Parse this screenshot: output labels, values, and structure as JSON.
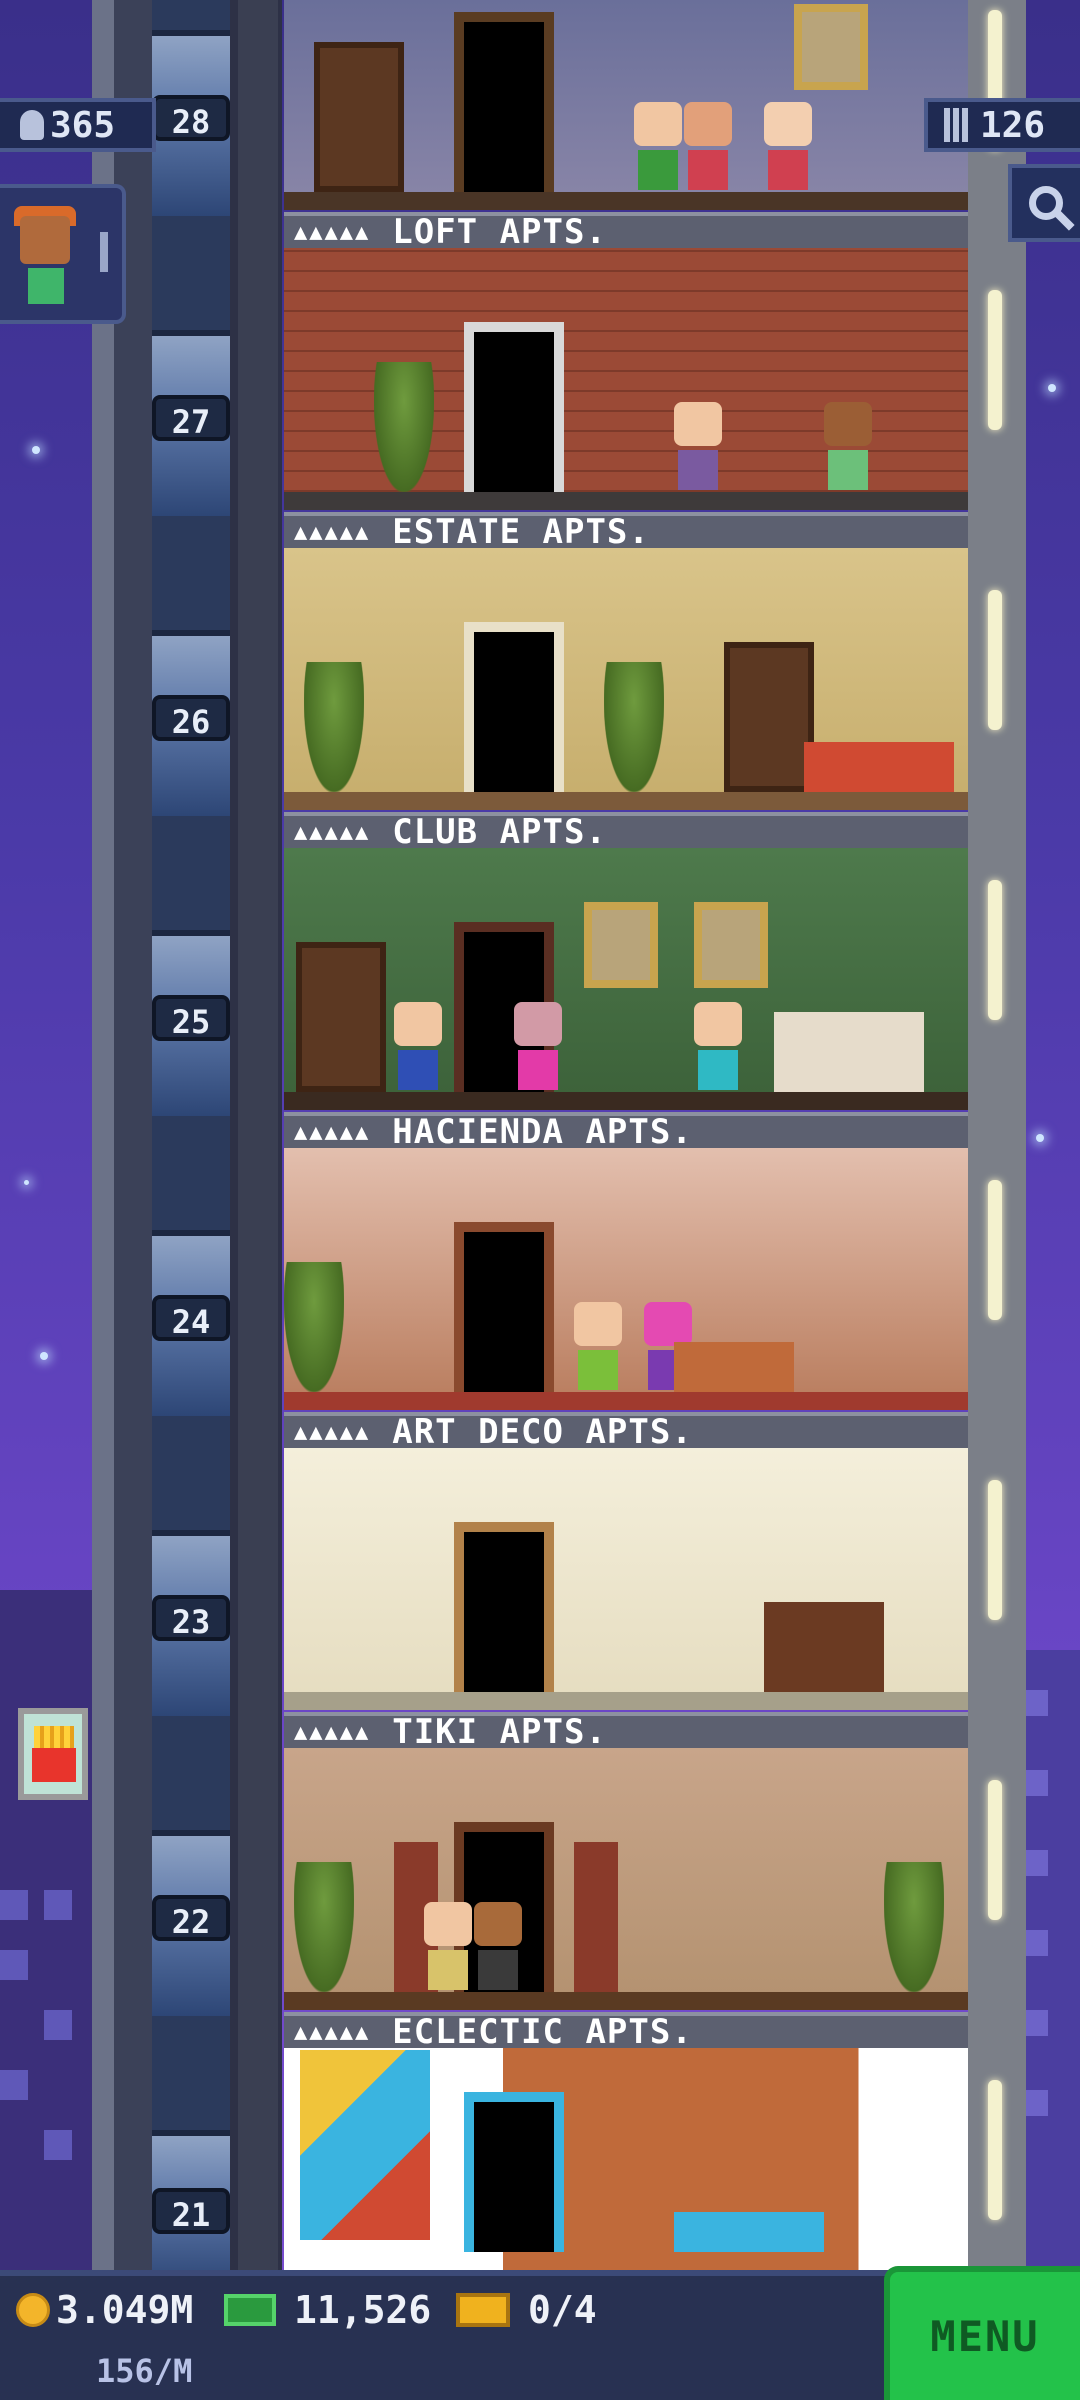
{
  "hud": {
    "population": "365",
    "floors_count": "126",
    "coins": "3.049M",
    "coins_rate": "156/M",
    "bux": "11,526",
    "tickets": "0/4",
    "menu_label": "MENU"
  },
  "floors": [
    {
      "number": "28",
      "label": "LOFT APTS.",
      "theme": "loft"
    },
    {
      "number": "27",
      "label": "ESTATE APTS.",
      "theme": "estate"
    },
    {
      "number": "26",
      "label": "CLUB APTS.",
      "theme": "club"
    },
    {
      "number": "25",
      "label": "HACIENDA APTS.",
      "theme": "hacienda"
    },
    {
      "number": "24",
      "label": "ART DECO APTS.",
      "theme": "artdeco"
    },
    {
      "number": "23",
      "label": "TIKI APTS.",
      "theme": "tiki"
    },
    {
      "number": "22",
      "label": "ECLECTIC APTS.",
      "theme": "eclectic"
    },
    {
      "number": "21",
      "label": "",
      "theme": "eclectic2"
    }
  ],
  "stars_label": "▲▲▲▲▲",
  "icons": {
    "population": "person-icon",
    "floors": "building-icon",
    "search": "magnifier-icon",
    "coins": "coin-icon",
    "bux": "bux-icon",
    "tickets": "ticket-icon",
    "event": "fries-icon"
  },
  "colors": {
    "sky_top": "#3a2f8a",
    "sky_bottom": "#7a4fd0",
    "menu_green": "#23c24a",
    "hud_bg": "#283152"
  }
}
